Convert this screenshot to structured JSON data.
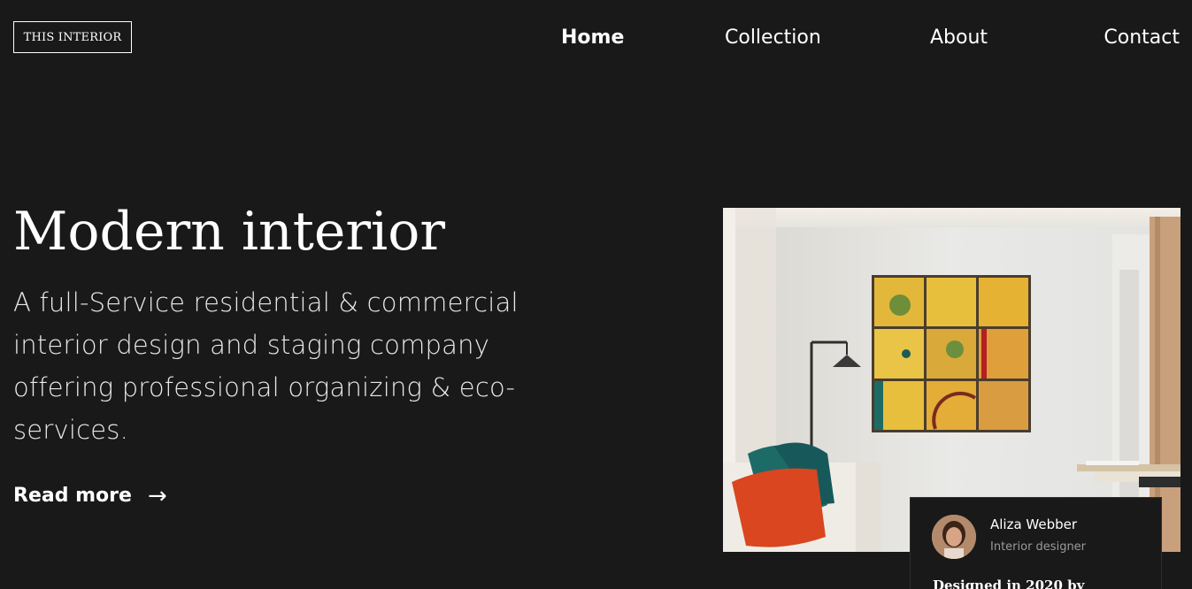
{
  "logo": {
    "text": "THIS INTERIOR"
  },
  "nav": {
    "items": [
      {
        "label": "Home",
        "active": true
      },
      {
        "label": "Collection",
        "active": false
      },
      {
        "label": "About",
        "active": false
      },
      {
        "label": "Contact",
        "active": false
      }
    ]
  },
  "hero": {
    "title": "Modern interior",
    "description": "A full-Service residential & commercial interior design and staging company offering professional organizing & eco-services.",
    "read_more_label": "Read more",
    "read_more_icon": "right-arrow-icon",
    "image_alt": "living room with yellow framed wall art, floor lamp and sofa with cushions"
  },
  "designer_card": {
    "name": "Aliza Webber",
    "role": "Interior designer",
    "designed_text": "Designed in 2020 by"
  },
  "colors": {
    "background": "#191919",
    "text": "#ffffff",
    "muted": "#9a9a9a"
  }
}
